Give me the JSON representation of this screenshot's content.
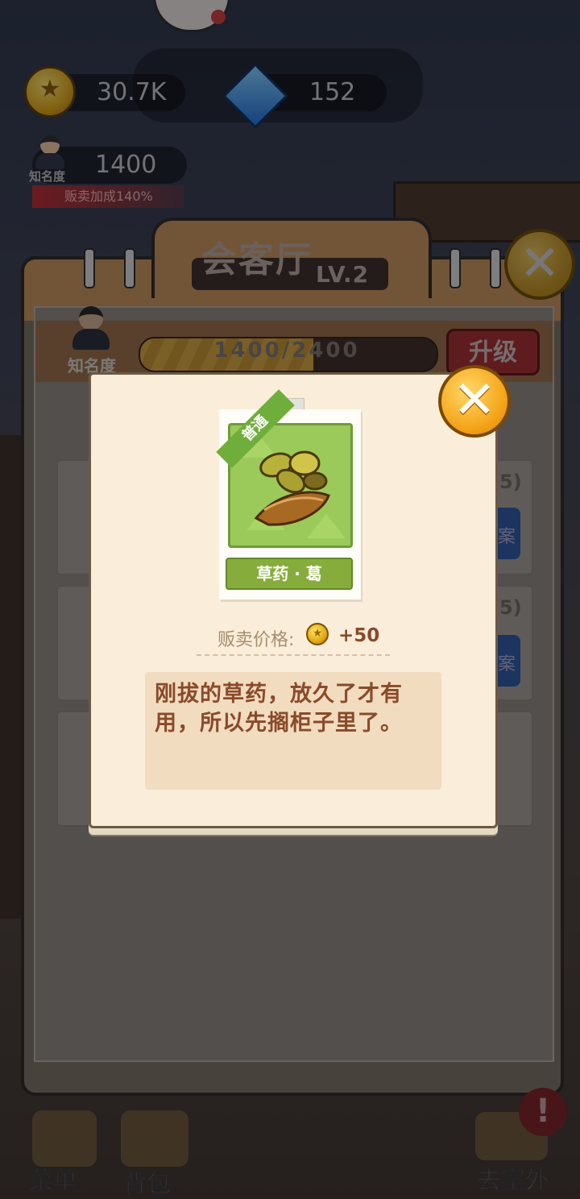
{
  "hud": {
    "coins": "30.7K",
    "diamonds": "152",
    "fame_label": "知名度",
    "fame_value": "1400",
    "sell_bonus": "贩卖加成140%"
  },
  "panel": {
    "title": "会客厅",
    "level": "LV.2",
    "fame_label": "知名度",
    "fame_progress_text": "1400/2400",
    "fame_progress": 0.5833,
    "upgrade_label": "升级",
    "list_counts": [
      "5)",
      "5)"
    ],
    "list_action_fragment": "案"
  },
  "item_popup": {
    "rarity": "普通",
    "name": "草药 · 葛",
    "price_label": "贩卖价格:",
    "price_value": "+50",
    "description": "刚拔的草药，放久了才有用，所以先搁柜子里了。"
  },
  "bottom_nav": {
    "menu_label": "菜单",
    "bag_label": "背包",
    "outdoor_label": "去室外",
    "alert": "!"
  },
  "icons": {
    "coin": "coin-icon",
    "diamond": "diamond-icon",
    "close": "close-icon",
    "herb": "herb-icon"
  },
  "colors": {
    "upgrade_red": "#a42a2a",
    "close_orange": "#f4a317",
    "rarity_green": "#6fae3a",
    "price_brown": "#8a4a2a"
  }
}
